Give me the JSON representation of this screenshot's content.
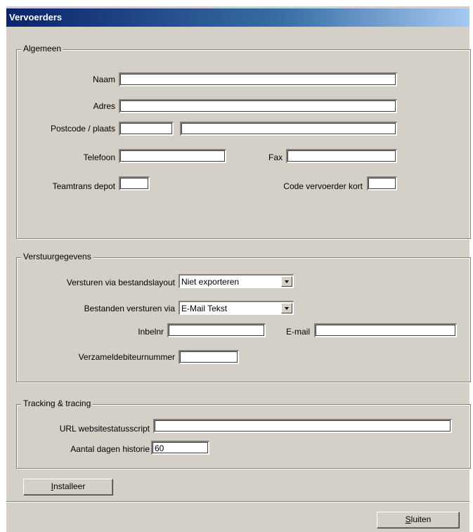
{
  "window": {
    "title": "Vervoerders"
  },
  "algemeen": {
    "legend": "Algemeen",
    "naam_label": "Naam",
    "naam_value": "",
    "adres_label": "Adres",
    "adres_value": "",
    "postcode_label": "Postcode / plaats",
    "postcode_value": "",
    "plaats_value": "",
    "telefoon_label": "Telefoon",
    "telefoon_value": "",
    "fax_label": "Fax",
    "fax_value": "",
    "depot_label": "Teamtrans depot",
    "depot_value": "",
    "code_label": "Code vervoerder kort",
    "code_value": ""
  },
  "verstuur": {
    "legend": "Verstuurgegevens",
    "layout_label": "Versturen via bestandslayout",
    "layout_value": "Niet exporteren",
    "via_label": "Bestanden versturen via",
    "via_value": "E-Mail Tekst",
    "inbelnr_label": "Inbelnr",
    "inbelnr_value": "",
    "email_label": "E-mail",
    "email_value": "",
    "verzamel_label": "Verzameldebiteurnummer",
    "verzamel_value": ""
  },
  "tracking": {
    "legend": "Tracking & tracing",
    "url_label": "URL websitestatusscript",
    "url_value": "",
    "dagen_label": "Aantal dagen historie",
    "dagen_value": "60"
  },
  "buttons": {
    "installeer_first": "I",
    "installeer_rest": "nstalleer",
    "sluiten_first": "S",
    "sluiten_rest": "luiten"
  }
}
